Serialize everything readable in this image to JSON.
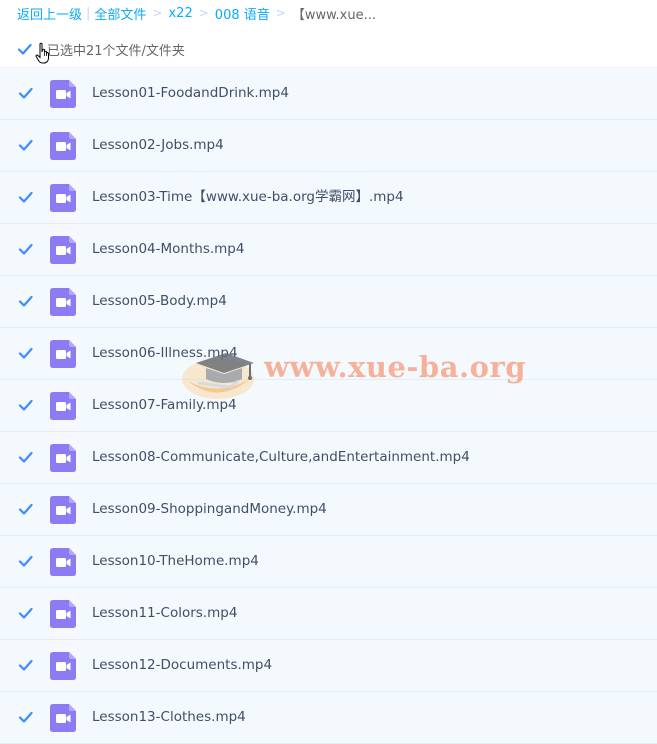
{
  "breadcrumb": {
    "back": "返回上一级",
    "all_files": "全部文件",
    "levels": [
      "x22",
      "008 语音"
    ],
    "current": "【www.xue..."
  },
  "selection": {
    "label": "已选中21个文件/文件夹",
    "all_checked": true
  },
  "files": [
    {
      "name": "Lesson01-FoodandDrink.mp4",
      "checked": true,
      "icon": "video-file-icon"
    },
    {
      "name": "Lesson02-Jobs.mp4",
      "checked": true,
      "icon": "video-file-icon"
    },
    {
      "name": "Lesson03-Time【www.xue-ba.org学霸网】.mp4",
      "checked": true,
      "icon": "video-file-icon"
    },
    {
      "name": "Lesson04-Months.mp4",
      "checked": true,
      "icon": "video-file-icon"
    },
    {
      "name": "Lesson05-Body.mp4",
      "checked": true,
      "icon": "video-file-icon"
    },
    {
      "name": "Lesson06-Illness.mp4",
      "checked": true,
      "icon": "video-file-icon"
    },
    {
      "name": "Lesson07-Family.mp4",
      "checked": true,
      "icon": "video-file-icon"
    },
    {
      "name": "Lesson08-Communicate,Culture,andEntertainment.mp4",
      "checked": true,
      "icon": "video-file-icon"
    },
    {
      "name": "Lesson09-ShoppingandMoney.mp4",
      "checked": true,
      "icon": "video-file-icon"
    },
    {
      "name": "Lesson10-TheHome.mp4",
      "checked": true,
      "icon": "video-file-icon"
    },
    {
      "name": "Lesson11-Colors.mp4",
      "checked": true,
      "icon": "video-file-icon"
    },
    {
      "name": "Lesson12-Documents.mp4",
      "checked": true,
      "icon": "video-file-icon"
    },
    {
      "name": "Lesson13-Clothes.mp4",
      "checked": true,
      "icon": "video-file-icon"
    }
  ],
  "watermark": {
    "text": "www.xue-ba.org"
  },
  "colors": {
    "accent": "#09aaff",
    "checkbox": "#3b8cff",
    "video_icon": "#8b7cf4",
    "row_bg": "#f4f9fe"
  }
}
